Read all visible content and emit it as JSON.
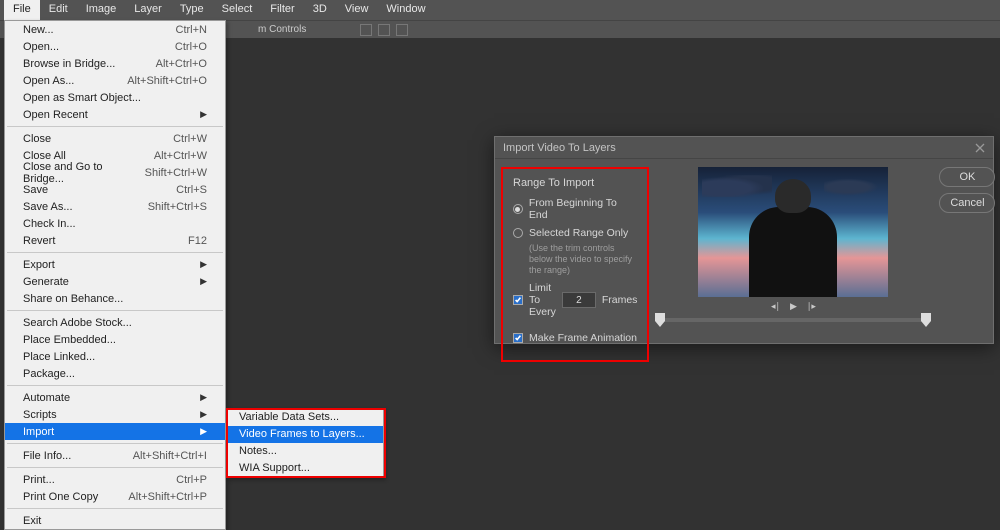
{
  "menubar": [
    "File",
    "Edit",
    "Image",
    "Layer",
    "Type",
    "Select",
    "Filter",
    "3D",
    "View",
    "Window"
  ],
  "menubar_active_index": 0,
  "optbar": {
    "controls_label": "m Controls"
  },
  "file_menu": {
    "g1": [
      {
        "label": "New...",
        "sc": "Ctrl+N"
      },
      {
        "label": "Open...",
        "sc": "Ctrl+O"
      },
      {
        "label": "Browse in Bridge...",
        "sc": "Alt+Ctrl+O"
      },
      {
        "label": "Open As...",
        "sc": "Alt+Shift+Ctrl+O"
      },
      {
        "label": "Open as Smart Object...",
        "sc": ""
      },
      {
        "label": "Open Recent",
        "sc": "",
        "sub": true
      }
    ],
    "g2": [
      {
        "label": "Close",
        "sc": "Ctrl+W"
      },
      {
        "label": "Close All",
        "sc": "Alt+Ctrl+W"
      },
      {
        "label": "Close and Go to Bridge...",
        "sc": "Shift+Ctrl+W"
      },
      {
        "label": "Save",
        "sc": "Ctrl+S"
      },
      {
        "label": "Save As...",
        "sc": "Shift+Ctrl+S"
      },
      {
        "label": "Check In...",
        "sc": ""
      },
      {
        "label": "Revert",
        "sc": "F12"
      }
    ],
    "g3": [
      {
        "label": "Export",
        "sc": "",
        "sub": true
      },
      {
        "label": "Generate",
        "sc": "",
        "sub": true
      },
      {
        "label": "Share on Behance...",
        "sc": ""
      }
    ],
    "g4": [
      {
        "label": "Search Adobe Stock...",
        "sc": ""
      },
      {
        "label": "Place Embedded...",
        "sc": ""
      },
      {
        "label": "Place Linked...",
        "sc": ""
      },
      {
        "label": "Package...",
        "sc": ""
      }
    ],
    "g5": [
      {
        "label": "Automate",
        "sc": "",
        "sub": true
      },
      {
        "label": "Scripts",
        "sc": "",
        "sub": true
      },
      {
        "label": "Import",
        "sc": "",
        "sub": true,
        "hl": true
      }
    ],
    "g6": [
      {
        "label": "File Info...",
        "sc": "Alt+Shift+Ctrl+I"
      }
    ],
    "g7": [
      {
        "label": "Print...",
        "sc": "Ctrl+P"
      },
      {
        "label": "Print One Copy",
        "sc": "Alt+Shift+Ctrl+P"
      }
    ],
    "g8": [
      {
        "label": "Exit",
        "sc": ""
      }
    ]
  },
  "import_submenu": [
    {
      "label": "Variable Data Sets..."
    },
    {
      "label": "Video Frames to Layers...",
      "hl": true
    },
    {
      "label": "Notes..."
    },
    {
      "label": "WIA Support..."
    }
  ],
  "dialog": {
    "title": "Import Video To Layers",
    "range_title": "Range To Import",
    "opt_beginning": "From Beginning To End",
    "opt_selected": "Selected Range Only",
    "help": "(Use the trim controls below the video to specify the range)",
    "limit_label": "Limit To Every",
    "limit_value": "2",
    "limit_unit": "Frames",
    "make_anim": "Make Frame Animation",
    "ok": "OK",
    "cancel": "Cancel"
  }
}
